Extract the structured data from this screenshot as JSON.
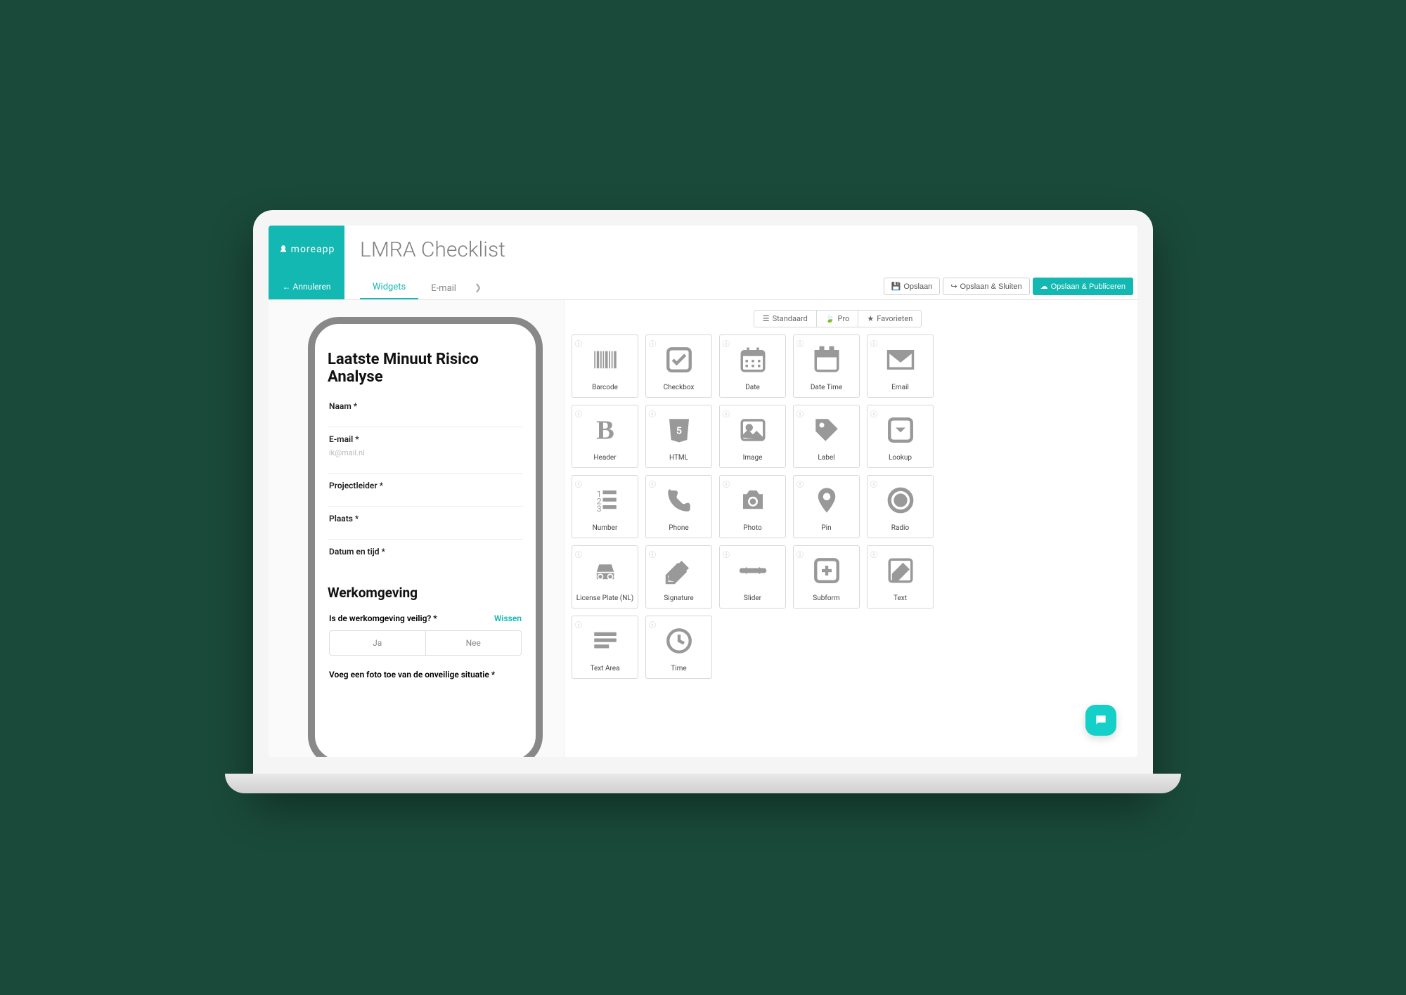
{
  "brand": "moreapp",
  "page_title": "LMRA Checklist",
  "cancel_label": "Annuleren",
  "nav_tabs": {
    "widgets": "Widgets",
    "email": "E-mail"
  },
  "actions": {
    "save": "Opslaan",
    "save_close": "Opslaan & Sluiten",
    "save_publish": "Opslaan & Publiceren"
  },
  "preview": {
    "form_title": "Laatste Minuut Risico Analyse",
    "fields": {
      "name": "Naam *",
      "email": "E-mail *",
      "email_placeholder": "ik@mail.nl",
      "project_leader": "Projectleider *",
      "place": "Plaats *",
      "datetime": "Datum en tijd *"
    },
    "section2_title": "Werkomgeving",
    "q1": "Is de werkomgeving veilig? *",
    "wissen": "Wissen",
    "yes": "Ja",
    "no": "Nee",
    "q2": "Voeg een foto toe van de onveilige situatie *"
  },
  "palette_tabs": {
    "standard": "Standaard",
    "pro": "Pro",
    "favorites": "Favorieten"
  },
  "widgets": [
    {
      "id": "barcode",
      "label": "Barcode"
    },
    {
      "id": "checkbox",
      "label": "Checkbox"
    },
    {
      "id": "date",
      "label": "Date"
    },
    {
      "id": "datetime",
      "label": "Date Time"
    },
    {
      "id": "email",
      "label": "Email"
    },
    {
      "id": "header",
      "label": "Header"
    },
    {
      "id": "html",
      "label": "HTML"
    },
    {
      "id": "image",
      "label": "Image"
    },
    {
      "id": "label",
      "label": "Label"
    },
    {
      "id": "lookup",
      "label": "Lookup"
    },
    {
      "id": "number",
      "label": "Number"
    },
    {
      "id": "phone",
      "label": "Phone"
    },
    {
      "id": "photo",
      "label": "Photo"
    },
    {
      "id": "pin",
      "label": "Pin"
    },
    {
      "id": "radio",
      "label": "Radio"
    },
    {
      "id": "license",
      "label": "License Plate (NL)"
    },
    {
      "id": "signature",
      "label": "Signature"
    },
    {
      "id": "slider",
      "label": "Slider"
    },
    {
      "id": "subform",
      "label": "Subform"
    },
    {
      "id": "text",
      "label": "Text"
    },
    {
      "id": "textarea",
      "label": "Text Area"
    },
    {
      "id": "time",
      "label": "Time"
    }
  ]
}
